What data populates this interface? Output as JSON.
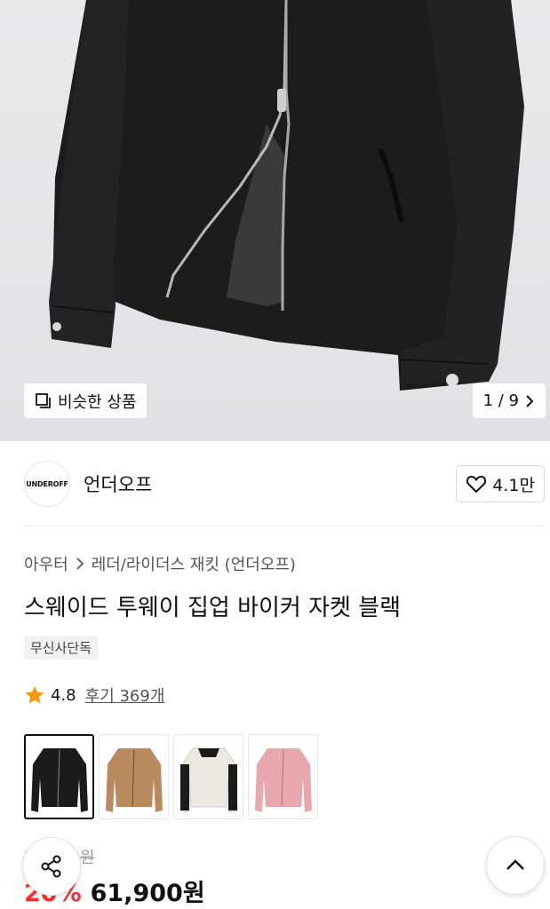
{
  "hero": {
    "similar_label": "비슷한 상품",
    "pager": "1 / 9"
  },
  "brand": {
    "logo_text": "UNDEROFF",
    "name": "언더오프",
    "likes": "4.1만"
  },
  "breadcrumb": {
    "category": "아우터",
    "subcategory": "레더/라이더스 재킷 (언더오프)"
  },
  "product": {
    "title": "스웨이드 투웨이 집업 바이커 자켓 블랙",
    "badge": "무신사단독",
    "rating": "4.8",
    "reviews": "후기 369개"
  },
  "colors": [
    {
      "name": "black",
      "hex": "#1b1b1b"
    },
    {
      "name": "camel",
      "hex": "#b98a5e"
    },
    {
      "name": "ivory-black",
      "hex": "#ece9e3"
    },
    {
      "name": "pink",
      "hex": "#e7a7ae"
    }
  ],
  "price": {
    "original": "77,000원",
    "discount": "20%",
    "sale": "61,900원"
  },
  "theme": {
    "accent_red": "#ff2d2d",
    "star_orange": "#f59a0b"
  }
}
